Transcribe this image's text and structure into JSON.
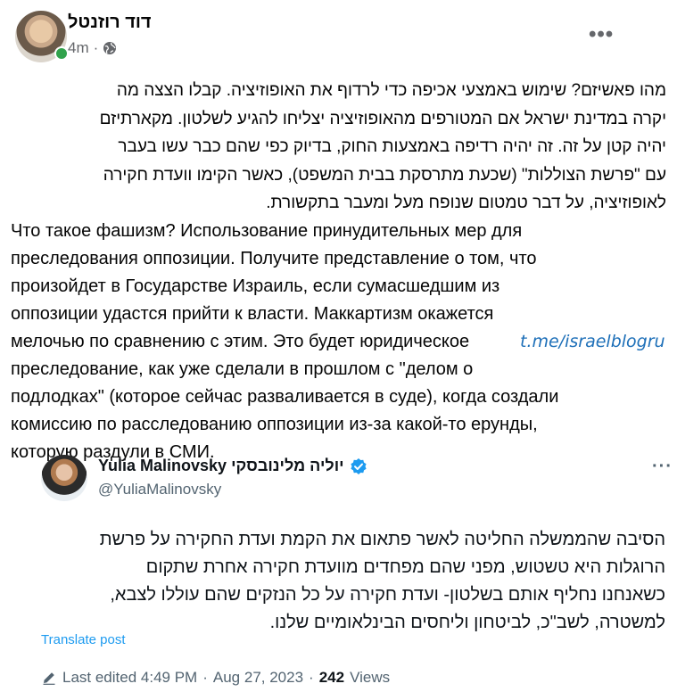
{
  "post": {
    "author_name": "דוד רוזנטל",
    "time_ago": "4m",
    "separator": "·",
    "hebrew_lines": [
      "מהו פאשיזם? שימוש באמצעי אכיפה כדי לרדוף את האופוזיציה. קבלו הצצה מה",
      "יקרה במדינת ישראל אם המטורפים מהאופוזיציה יצליחו להגיע לשלטון. מקארתיזם",
      "יהיה קטן על זה. זה יהיה רדיפה באמצעות החוק, בדיוק כפי שהם כבר עשו בעבר",
      "עם \"פרשת הצוללות\" (שכעת מתרסקת בבית המשפט), כאשר הקימו וועדת חקירה",
      "לאופוזיציה, על דבר טמטום שנופח מעל ומעבר בתקשורת."
    ],
    "russian_lines": [
      "Что такое фашизм? Использование принудительных мер для",
      "преследования оппозиции. Получите представление о том, что",
      "произойдет в Государстве Израиль, если сумасшедшим из",
      "оппозиции удастся прийти к власти. Маккартизм окажется",
      "мелочью по сравнению с этим. Это будет юридическое",
      "преследование, как уже сделали в прошлом с \"делом о",
      "подлодках\" (которое сейчас разваливается в суде), когда создали",
      "комиссию по расследованию оппозиции из-за какой-то ерунды,",
      "которую раздули в СМИ."
    ],
    "watermark": "t.me/israelblogru"
  },
  "tweet": {
    "display_name": "Yulia Malinovsky יוליה מלינובסקי",
    "handle": "@YuliaMalinovsky",
    "lines": [
      "הסיבה שהממשלה החליטה לאשר פתאום את הקמת ועדת החקירה על פרשת",
      "הרוגלות היא טשטוש, מפני שהם מפחדים מוועדת חקירה אחרת שתקום",
      "כשאנחנו נחליף אותם בשלטון- ועדת חקירה על כל הנזקים שהם עוללו לצבא,",
      "למשטרה, לשב\"כ, לביטחון וליחסים הבינלאומיים שלנו."
    ],
    "translate_label": "Translate post",
    "footer": {
      "edited_label": "Last edited 4:49 PM",
      "dot1": "·",
      "date": "Aug 27, 2023",
      "dot2": "·",
      "views_count": "242",
      "views_label": "Views"
    }
  },
  "icons": {
    "globe": "globe-icon",
    "more": "more-options-icon",
    "verified": "verified-badge-icon",
    "pencil": "pencil-icon"
  },
  "colors": {
    "link_blue": "#1d9bf0",
    "verified_blue": "#1d9bf0",
    "online_green": "#31a24c",
    "watermark_blue": "#1d6fb8"
  }
}
